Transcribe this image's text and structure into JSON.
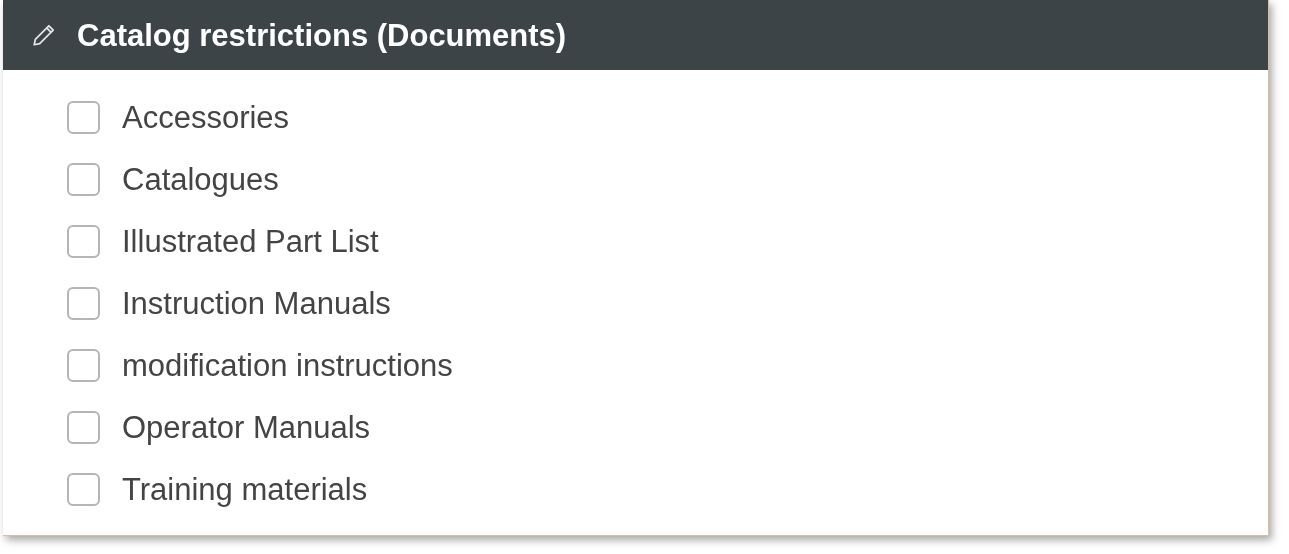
{
  "panel": {
    "title": "Catalog restrictions (Documents)"
  },
  "items": [
    {
      "label": "Accessories",
      "checked": false
    },
    {
      "label": "Catalogues",
      "checked": false
    },
    {
      "label": "Illustrated Part List",
      "checked": false
    },
    {
      "label": "Instruction Manuals",
      "checked": false
    },
    {
      "label": "modification instructions",
      "checked": false
    },
    {
      "label": "Operator Manuals",
      "checked": false
    },
    {
      "label": "Training materials",
      "checked": false
    }
  ]
}
